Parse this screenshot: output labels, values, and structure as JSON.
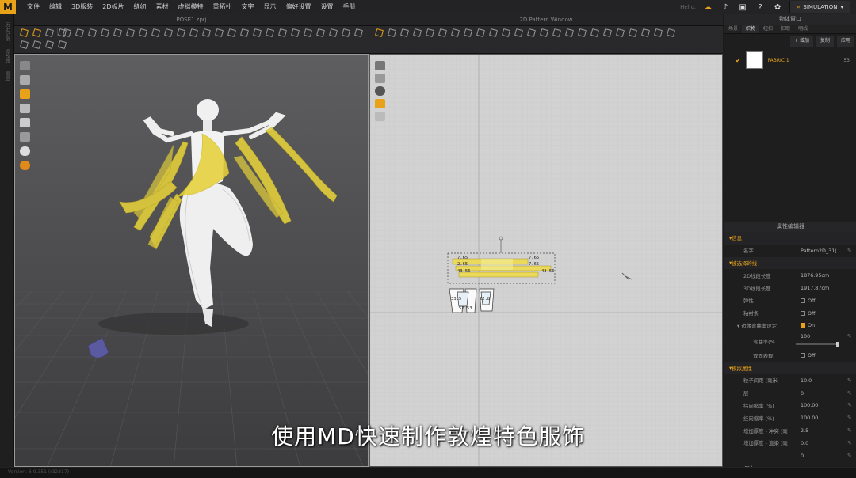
{
  "app": {
    "logo": "M"
  },
  "menu": [
    "文件",
    "编辑",
    "3D服装",
    "2D板片",
    "缝纫",
    "素材",
    "虚拟模特",
    "重拓扑",
    "文字",
    "显示",
    "偏好设置",
    "设置",
    "手册"
  ],
  "topbar": {
    "user": "Hello,",
    "mode_label": "SIMULATION"
  },
  "left_sidebar": [
    "历史记录",
    "修改器",
    "图层"
  ],
  "view3d": {
    "title": "POSE1.zprj"
  },
  "view2d": {
    "title": "2D Pattern Window"
  },
  "object_window": {
    "title": "物体窗口",
    "tabs": [
      "场景",
      "织物",
      "纽扣",
      "扣眼",
      "明线"
    ],
    "active_tab": "织物",
    "add_label": "+ 增加",
    "copy_label": "复制",
    "apply_label": "应用",
    "fabric": {
      "name": "FABRIC 1",
      "count": "53"
    }
  },
  "property_editor": {
    "title": "属性编辑器",
    "sections": {
      "info": "信息",
      "selected_lines": "被选择的线",
      "sim": "模拟属性"
    },
    "rows": {
      "name_k": "名字",
      "name_v": "Pattern2D_31(",
      "len2d_k": "2D线段长度",
      "len2d_v": "1876.95cm",
      "len3d_k": "3D线段长度",
      "len3d_v": "1917.87cm",
      "elastic_k": "弹性",
      "elastic_v": "Off",
      "bond_k": "粘衬条",
      "bond_v": "Off",
      "curve_k": "边缘弯曲率设定",
      "curve_v": "On",
      "curvature_k": "弯曲率(%",
      "curvature_v": "100",
      "dbl_k": "双面表现",
      "dbl_v": "Off",
      "particle_k": "粒子间距 (毫米",
      "particle_v": "10.0",
      "layer_k": "层",
      "layer_v": "0",
      "warp_k": "纬向缩率 (%)",
      "warp_v": "100.00",
      "weft_k": "经向缩率 (%)",
      "weft_v": "100.00",
      "thick_k": "增加厚度 - 冲突 (毫",
      "thick_v": "2.5",
      "thickr_k": "增加厚度 - 渲染 (毫",
      "thickr_v": "0.0",
      "extra_v": "0",
      "pressure_k": "压力"
    }
  },
  "pattern_labels": {
    "a": "7.65",
    "b": "7.65",
    "c": "43.56",
    "d": "43.56",
    "e": "2.65",
    "f": "7.65",
    "g": "33.5",
    "h": "22.8",
    "i": "52.53"
  },
  "status_text": "Version: 6.0.351 (r32317)",
  "subtitle": "使用MD快速制作敦煌特色服饰",
  "colors": {
    "accent": "#e8a21a",
    "ribbon": "#e6d23c"
  }
}
